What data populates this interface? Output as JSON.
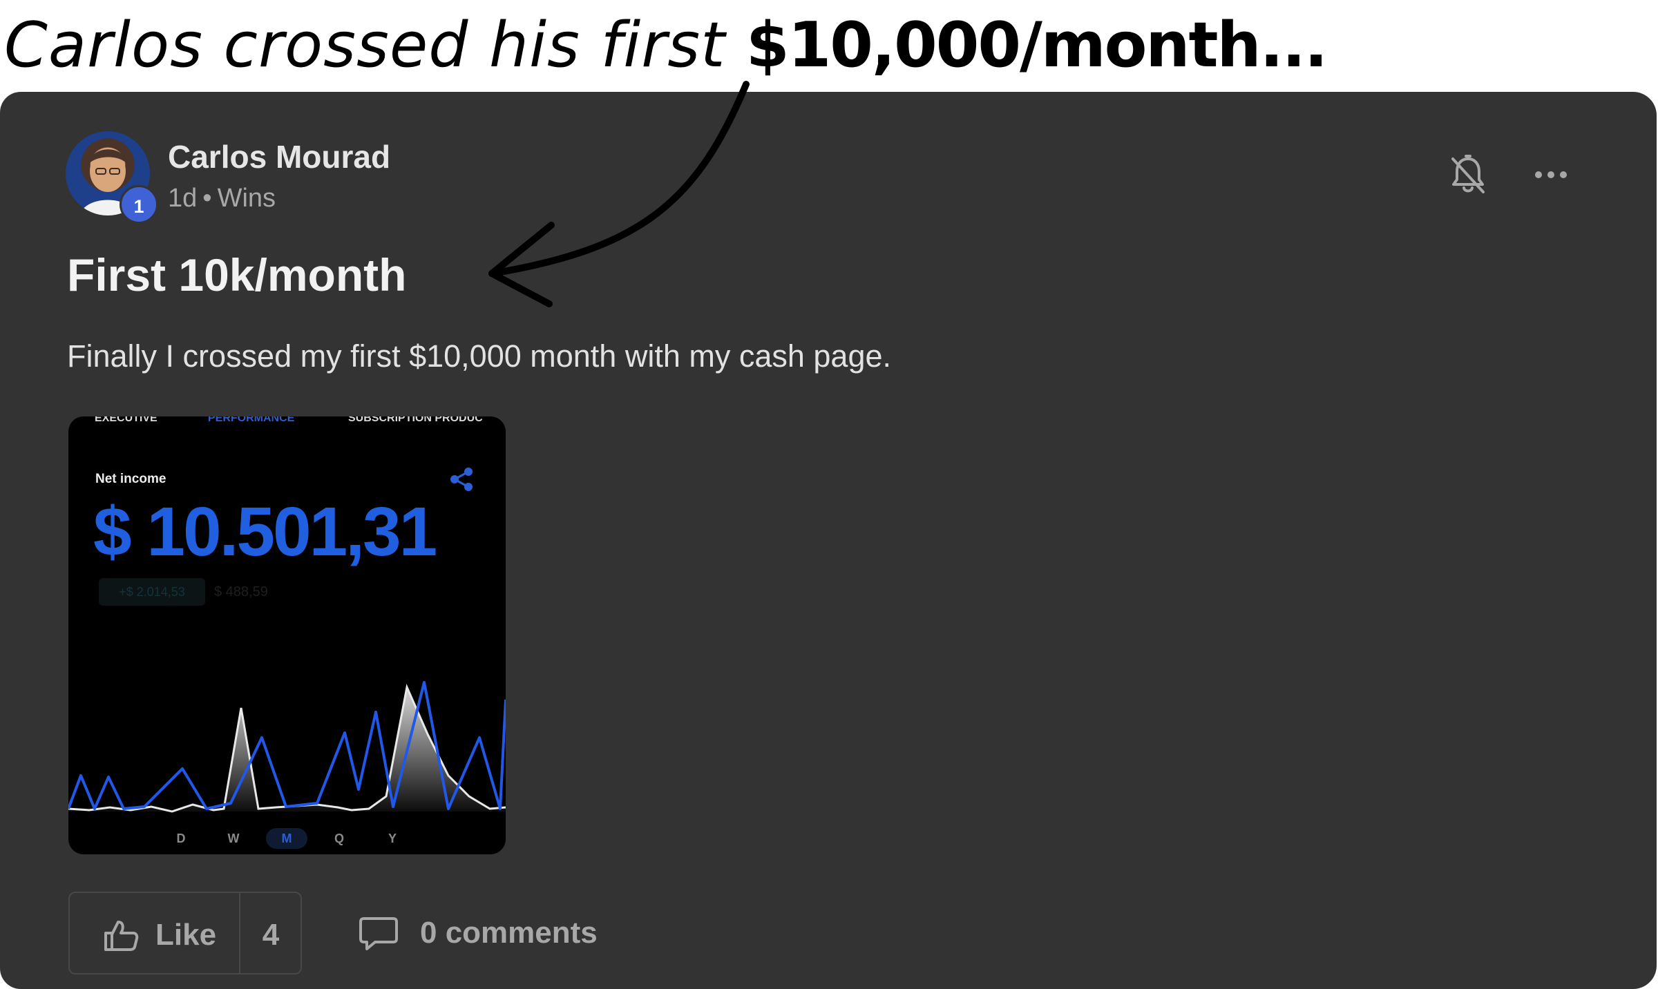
{
  "caption": {
    "plain": "Carlos crossed his first ",
    "bold": "$10,000/month..."
  },
  "post": {
    "author": "Carlos Mourad",
    "avatar_badge": "1",
    "age": "1d",
    "separator": "•",
    "category": "Wins",
    "title": "First 10k/month",
    "body": "Finally I crossed my first $10,000 month with my cash page."
  },
  "screenshot": {
    "tabs": [
      "EXECUTIVE",
      "PERFORMANCE",
      "SUBSCRIPTION PRODUC"
    ],
    "active_tab": "PERFORMANCE",
    "net_income_label": "Net income",
    "net_income_value": "$ 10.501,31",
    "sub_pill": "+$ 2.014,53",
    "sub_value": "$ 488,59",
    "periods": [
      "D",
      "W",
      "M",
      "Q",
      "Y"
    ],
    "active_period": "M"
  },
  "actions": {
    "like_label": "Like",
    "like_count": "4",
    "comments_label": "0 comments"
  },
  "icons": {
    "bell": "bell-muted-icon",
    "more": "more-horizontal-icon",
    "thumb": "thumbs-up-icon",
    "comment": "comment-bubble-icon",
    "share": "share-icon"
  },
  "colors": {
    "card_bg": "#333333",
    "accent_blue": "#1f5fe0",
    "badge_blue": "#3f63d6",
    "muted_text": "#a8a8a8"
  }
}
